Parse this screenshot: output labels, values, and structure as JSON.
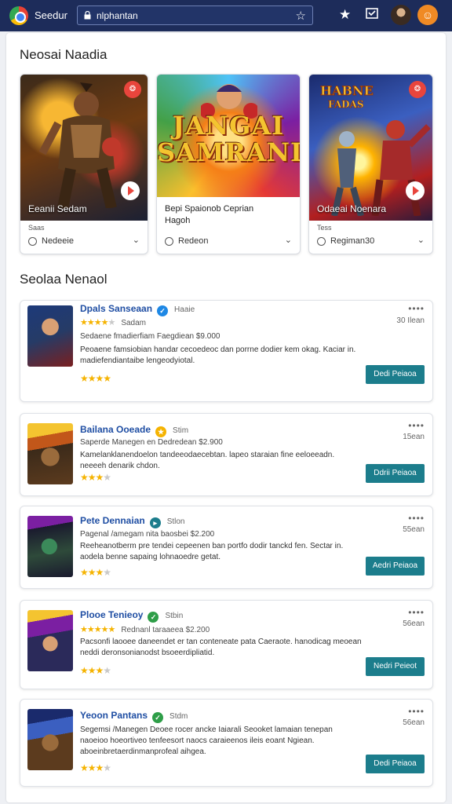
{
  "topbar": {
    "brand": "Seedur",
    "search_value": "nlphantan",
    "icons": [
      "lock-icon",
      "bookmark-star-icon",
      "star-icon",
      "inbox-icon",
      "profile-avatar",
      "account-avatar"
    ],
    "accent": "#1d2c5a"
  },
  "featured": {
    "title": "Neosai Naadia",
    "cards": [
      {
        "name": "Eeanii Sedam",
        "sub": "Saas",
        "meta": "Nedeeie"
      },
      {
        "title_art_line1": "JANGAI",
        "title_art_line2": "SAMRANI",
        "desc_line1": "Bepi Spaionob Ceprian",
        "desc_line2": "Hagoh",
        "meta": "Redeon"
      },
      {
        "name": "Odaeai Noenara",
        "sub": "Tess",
        "meta": "Regiman30"
      }
    ]
  },
  "list": {
    "title": "Seolaa Nenaol",
    "items": [
      {
        "name": "Dpals Sanseaan",
        "tag": "Haaie",
        "verify_color": "#1e88e5",
        "verify_icon": "✓",
        "stars_meta": "Sadam",
        "price": "Sedaene fmadierfiam Faegdiean $9.000",
        "desc_line1": "Peoaene famsiobian handar cecoedeoc dan porrne dodier kem okag. Kaciar in.",
        "desc_line2": "madiefendiantaibe lengeodyiotal.",
        "time": "30 Ilean",
        "button": "Dedi Peiaoa",
        "rating": 4
      },
      {
        "name": "Bailana Ooeade",
        "tag": "Stim",
        "verify_color": "#f5b301",
        "verify_icon": "★",
        "stars_meta": "",
        "price": "Saperde Manegen en Dedredean $2.900",
        "desc_line1": "Kamelanklanendoelon tandeeodaecebtan. lapeo staraian fine eeloeeadn.",
        "desc_line2": "neeeeh denarik chdon.",
        "time": "15ean",
        "button": "Ddrii Peiaoa",
        "rating": 3
      },
      {
        "name": "Pete Dennaian",
        "tag": "Stlon",
        "verify_color": "#1c7d8c",
        "verify_icon": "▸",
        "stars_meta": "",
        "price": "Pagenal /amegam nita baosbei $2.200",
        "desc_line1": "Reeheanotberm pre tendei cepeenen ban portfo dodir tanckd fen. Sectar in.",
        "desc_line2": "aodela benne sapaing lohnaoedre getat.",
        "time": "55ean",
        "button": "Aedri Peiaoa",
        "rating": 3
      },
      {
        "name": "Plooe Tenieoy",
        "tag": "Stbin",
        "verify_color": "#2e9e48",
        "verify_icon": "✓",
        "stars_meta": "Rednanl taraaeea $2.200",
        "price": "",
        "desc_line1": "Pacsonfi laooee daneendet er tan conteneate pata Caeraote. hanodicag meoean",
        "desc_line2": "neddi deronsonianodst bsoeerdipliatid.",
        "time": "56ean",
        "button": "Nedri Peieot",
        "rating": 3
      },
      {
        "name": "Yeoon Pantans",
        "tag": "Stdm",
        "verify_color": "#2e9e48",
        "verify_icon": "✓",
        "stars_meta": "",
        "price": "",
        "desc_line1": "Segemsi /Manegen Deoee rocer ancke Iaiarali Seooket lamaian tenepan",
        "desc_line2": "naoeioo hoeortiveo tenfeesort naocs caraieenos ileis eoant Ngiean.",
        "desc_line3": "aboeinbretaerdinmanprofeal aihgea.",
        "time": "56ean",
        "button": "Dedi Peiaoa",
        "rating": 3
      }
    ]
  }
}
